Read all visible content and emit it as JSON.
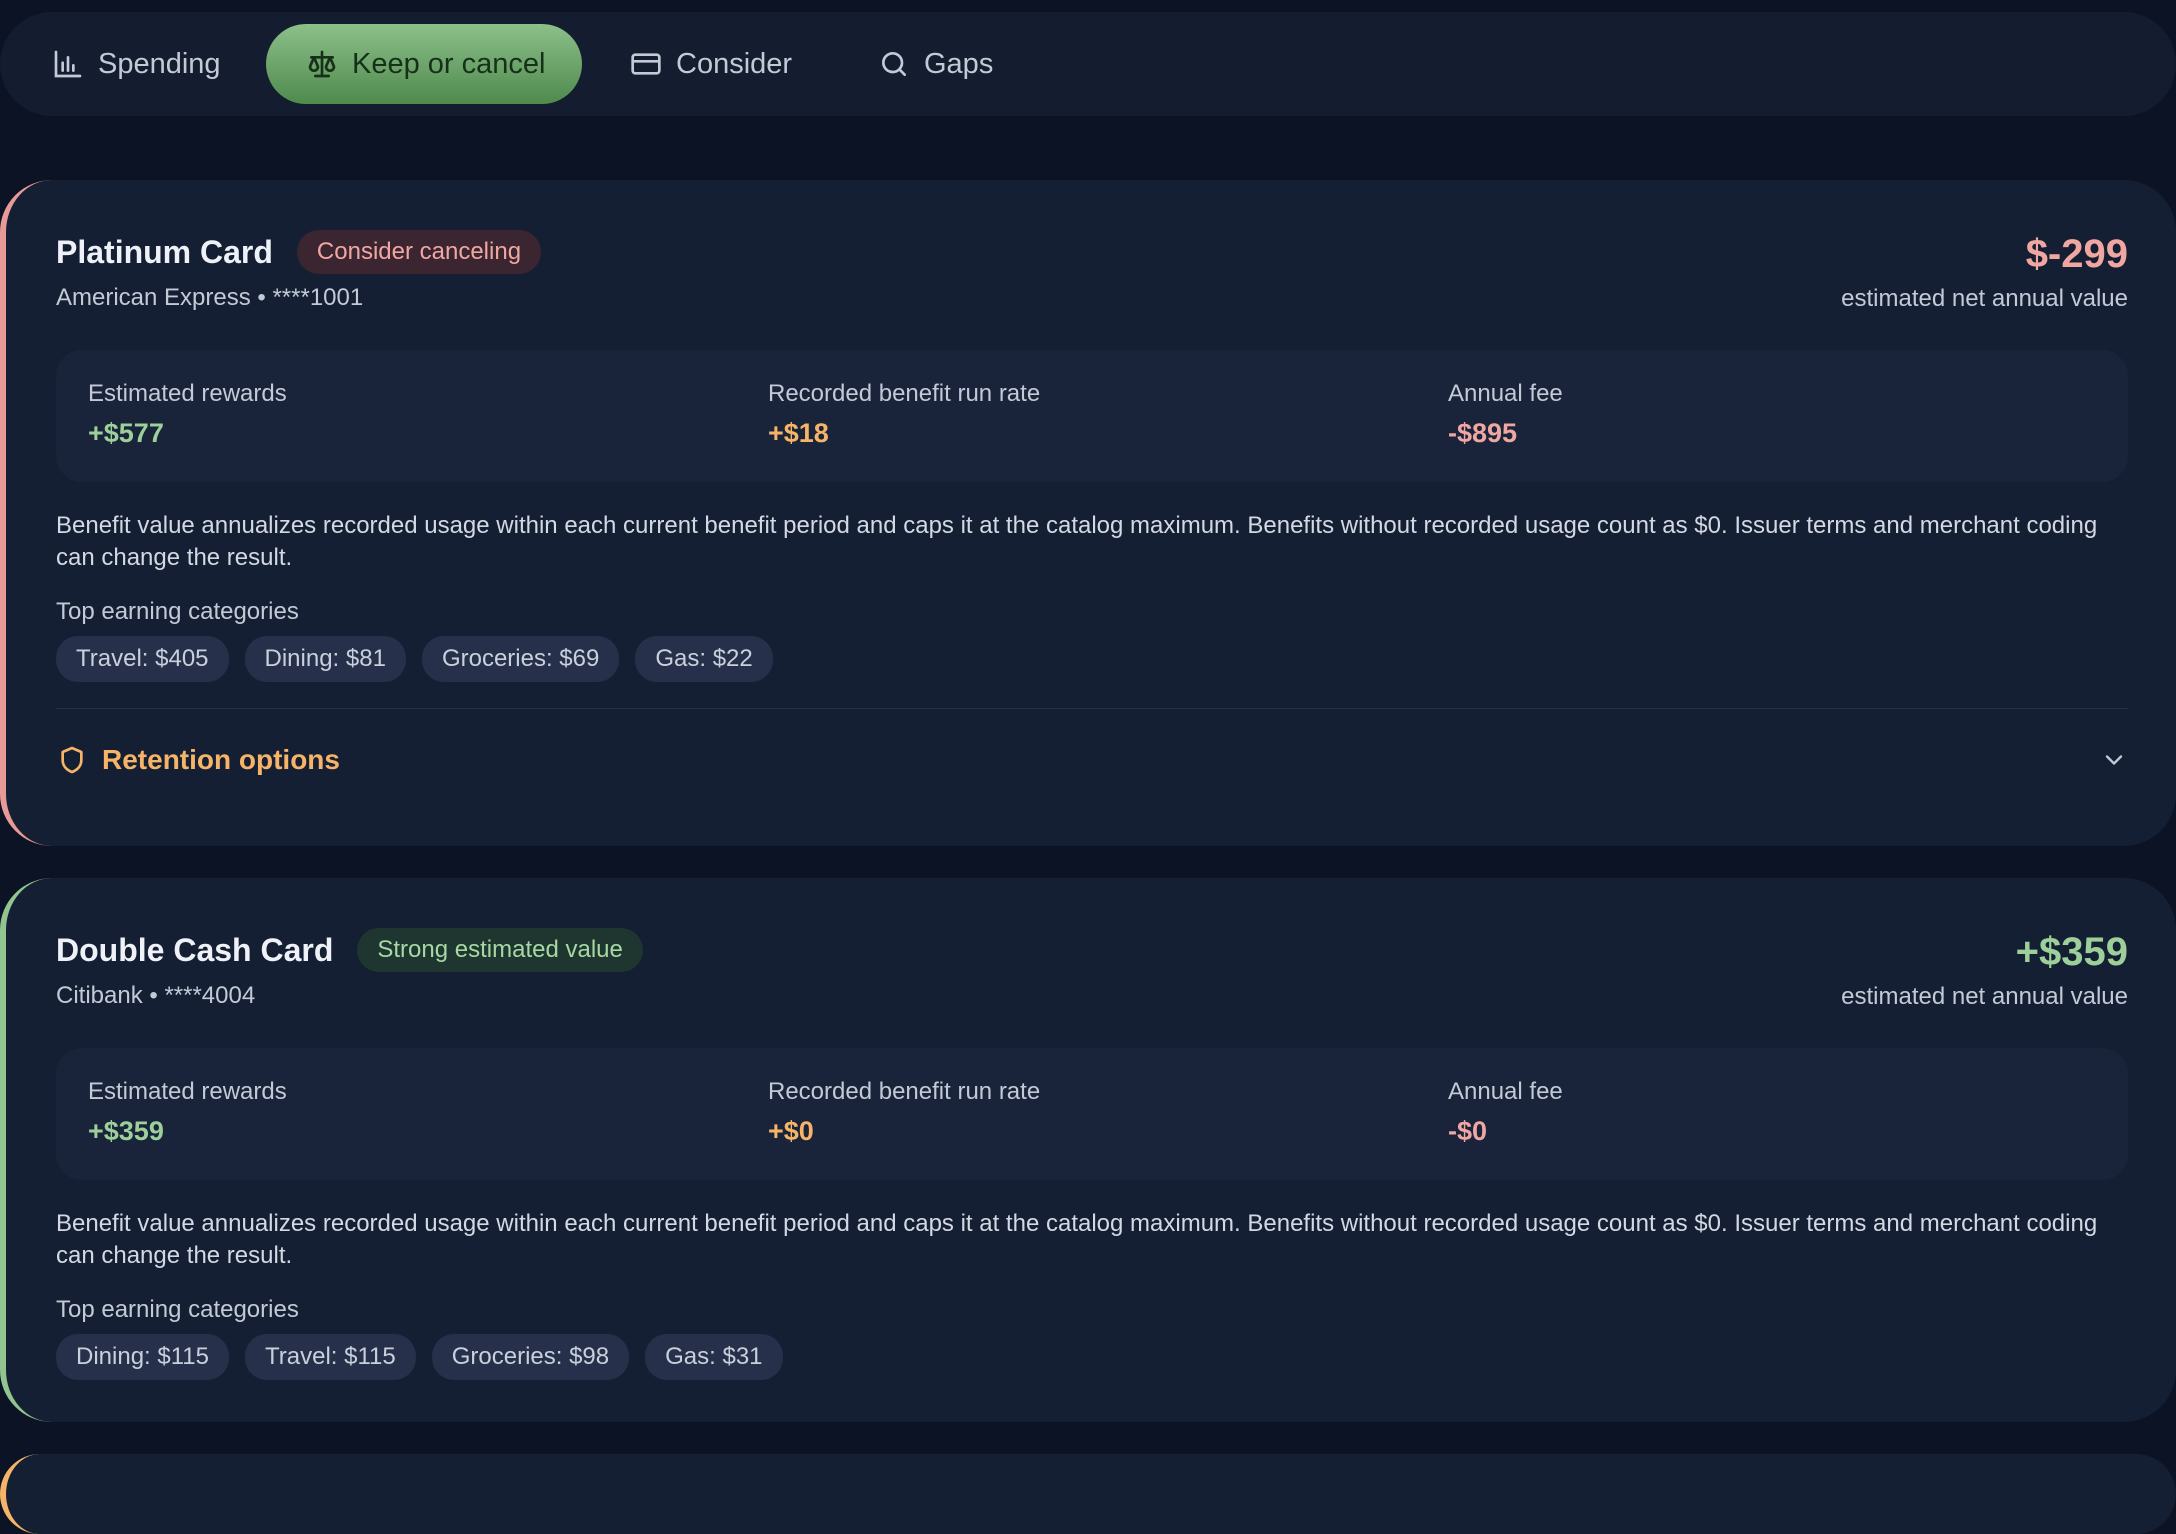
{
  "tabs": [
    {
      "label": "Spending",
      "icon": "bar-chart-icon",
      "active": false
    },
    {
      "label": "Keep or cancel",
      "icon": "scale-icon",
      "active": true
    },
    {
      "label": "Consider",
      "icon": "credit-card-icon",
      "active": false
    },
    {
      "label": "Gaps",
      "icon": "search-icon",
      "active": false
    }
  ],
  "colors": {
    "background": "#0b1324",
    "card": "#151f33",
    "active_tab": "#6fa66d",
    "positive": "#9ccf9a",
    "warning": "#f5b468",
    "negative": "#f0a7a2"
  },
  "cards": [
    {
      "title": "Platinum Card",
      "badge": "Consider canceling",
      "subtitle": "American Express • ****1001",
      "net_value": "$-299",
      "net_label": "estimated net annual value",
      "metrics": [
        {
          "label": "Estimated rewards",
          "value": "+$577"
        },
        {
          "label": "Recorded benefit run rate",
          "value": "+$18"
        },
        {
          "label": "Annual fee",
          "value": "-$895"
        }
      ],
      "note": "Benefit value annualizes recorded usage within each current benefit period and caps it at the catalog maximum. Benefits without recorded usage count as $0. Issuer terms and merchant coding can change the result.",
      "categories_label": "Top earning categories",
      "categories": [
        "Travel: $405",
        "Dining: $81",
        "Groceries: $69",
        "Gas: $22"
      ],
      "retention_label": "Retention options"
    },
    {
      "title": "Double Cash Card",
      "badge": "Strong estimated value",
      "subtitle": "Citibank • ****4004",
      "net_value": "+$359",
      "net_label": "estimated net annual value",
      "metrics": [
        {
          "label": "Estimated rewards",
          "value": "+$359"
        },
        {
          "label": "Recorded benefit run rate",
          "value": "+$0"
        },
        {
          "label": "Annual fee",
          "value": "-$0"
        }
      ],
      "note": "Benefit value annualizes recorded usage within each current benefit period and caps it at the catalog maximum. Benefits without recorded usage count as $0. Issuer terms and merchant coding can change the result.",
      "categories_label": "Top earning categories",
      "categories": [
        "Dining: $115",
        "Travel: $115",
        "Groceries: $98",
        "Gas: $31"
      ]
    }
  ]
}
